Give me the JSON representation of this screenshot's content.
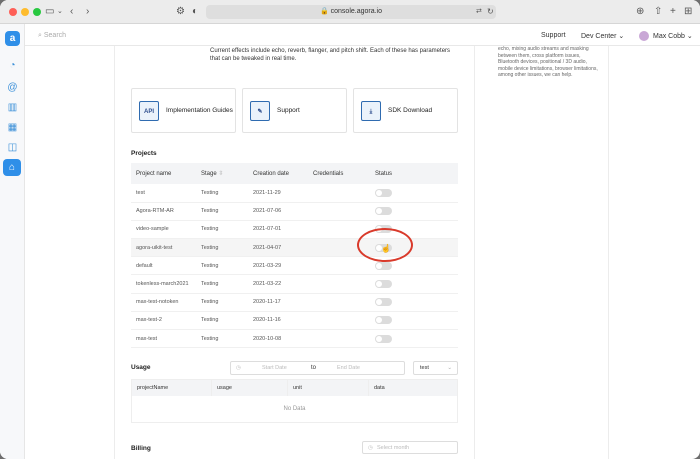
{
  "browser": {
    "url": "console.agora.io"
  },
  "search": {
    "placeholder": "Search"
  },
  "topnav": {
    "support": "Support",
    "dev_center": "Dev Center",
    "user": "Max Cobb"
  },
  "description": "Current effects include echo, reverb, flanger, and pitch shift. Each of these has parameters that can be tweaked in real time.",
  "right_panel": "echo, mixing audio streams and masking between them, cross platform issues, Bluetooth devices, positional / 3D audio, mobile device limitations, browser limitations, among other issues, we can help.",
  "cards": [
    {
      "label": "Implementation Guides",
      "icon": "api-book-icon"
    },
    {
      "label": "Support",
      "icon": "support-docs-icon"
    },
    {
      "label": "SDK Download",
      "icon": "download-tray-icon"
    }
  ],
  "projects": {
    "title": "Projects",
    "columns": [
      "Project name",
      "Stage",
      "Creation date",
      "Credentials",
      "Status"
    ],
    "rows": [
      {
        "name": "test",
        "stage": "Testing",
        "date": "2021-11-29"
      },
      {
        "name": "Agora-RTM-AR",
        "stage": "Testing",
        "date": "2021-07-06"
      },
      {
        "name": "video-sample",
        "stage": "Testing",
        "date": "2021-07-01"
      },
      {
        "name": "agora-uikit-test",
        "stage": "Testing",
        "date": "2021-04-07"
      },
      {
        "name": "default",
        "stage": "Testing",
        "date": "2021-03-29"
      },
      {
        "name": "tokenless-march2021",
        "stage": "Testing",
        "date": "2021-03-22"
      },
      {
        "name": "max-test-notoken",
        "stage": "Testing",
        "date": "2020-11-17"
      },
      {
        "name": "max-test-2",
        "stage": "Testing",
        "date": "2020-11-16"
      },
      {
        "name": "max-test",
        "stage": "Testing",
        "date": "2020-10-08"
      }
    ]
  },
  "usage": {
    "title": "Usage",
    "start_placeholder": "Start Date",
    "to": "to",
    "end_placeholder": "End Date",
    "select_value": "test",
    "columns": [
      "projectName",
      "usage",
      "unit",
      "data"
    ],
    "empty": "No Data"
  },
  "billing": {
    "title": "Billing",
    "month_placeholder": "Select month"
  },
  "colors": {
    "accent": "#2f8fe8",
    "highlight": "#d93a2b"
  }
}
